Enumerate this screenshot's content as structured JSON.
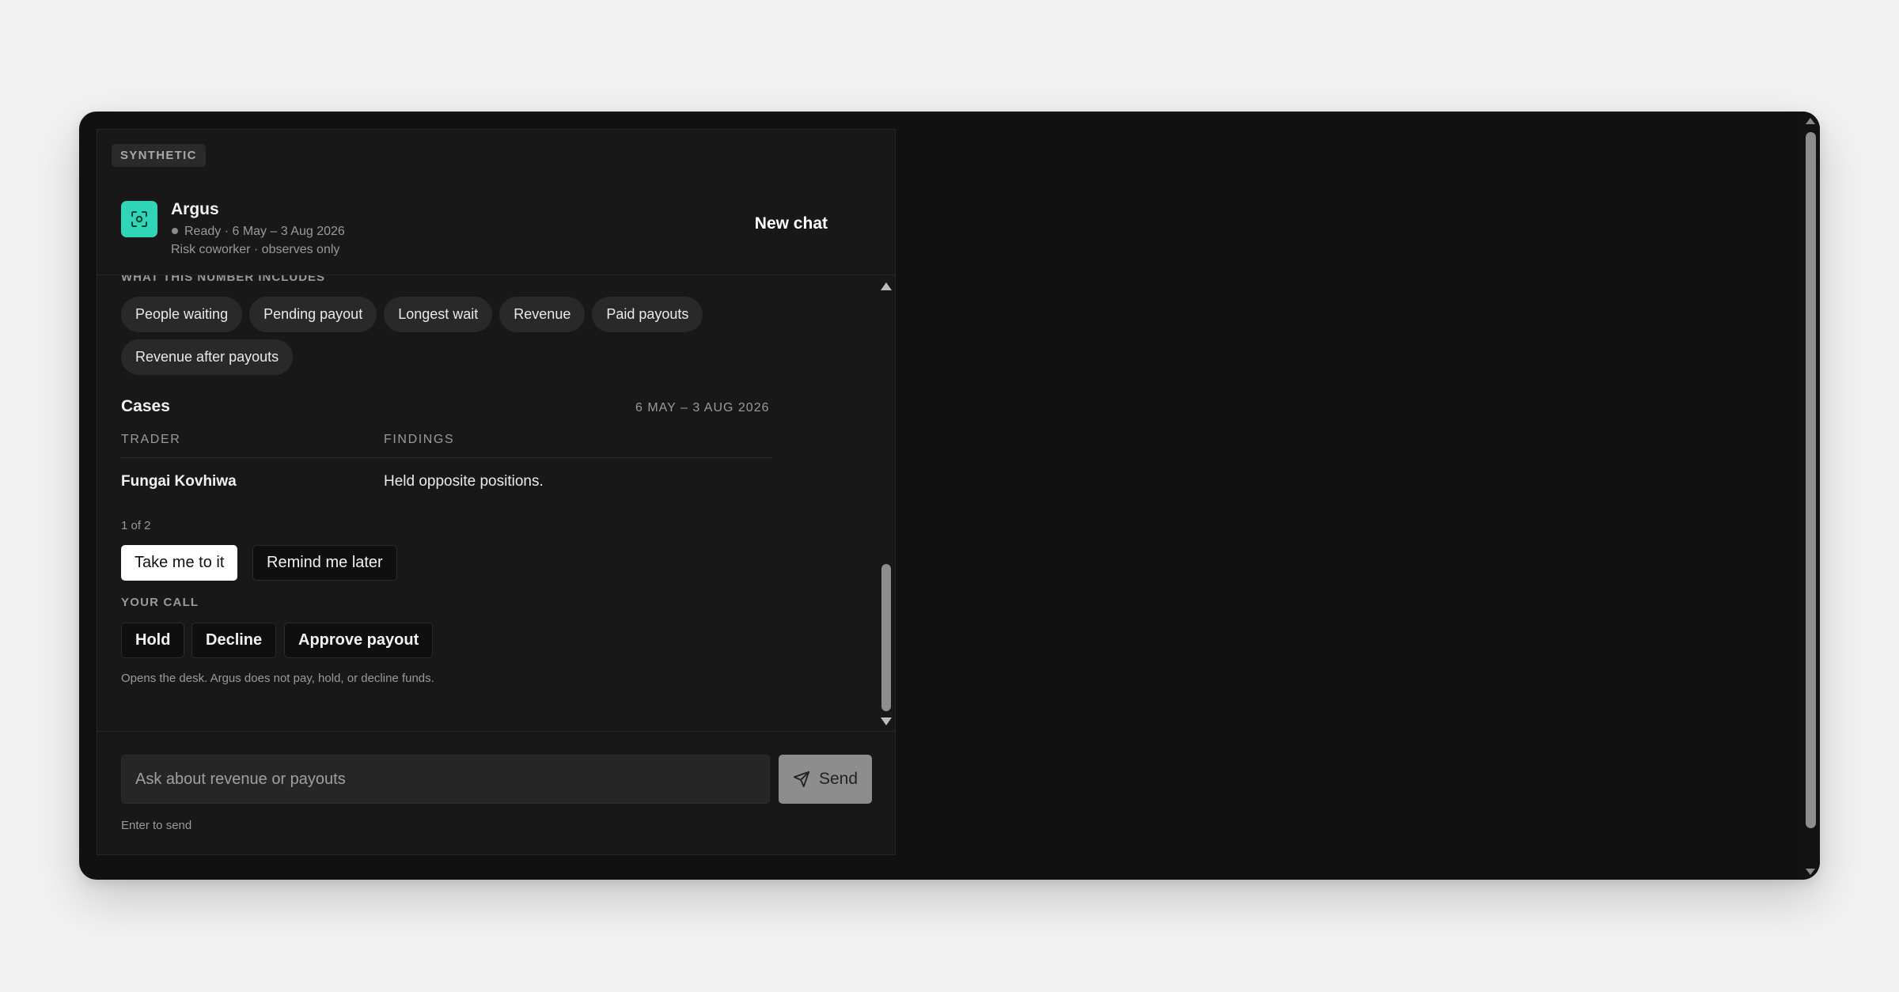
{
  "header": {
    "tag": "SYNTHETIC",
    "assistant_name": "Argus",
    "status": "Ready · 6 May – 3 Aug 2026",
    "role": "Risk coworker · observes only",
    "new_chat_label": "New chat",
    "avatar_icon": "focus-scan-icon",
    "accent_color": "#2ed6b7"
  },
  "breakdown": {
    "section_label": "WHAT THIS NUMBER INCLUDES",
    "chips": [
      "People waiting",
      "Pending payout",
      "Longest wait",
      "Revenue",
      "Paid payouts",
      "Revenue after payouts"
    ]
  },
  "cases": {
    "title": "Cases",
    "range": "6 MAY – 3 AUG 2026",
    "columns": [
      "TRADER",
      "FINDINGS"
    ],
    "rows": [
      {
        "trader": "Fungai Kovhiwa",
        "findings": "Held opposite positions."
      }
    ],
    "pager": "1 of 2",
    "primary_action": "Take me to it",
    "secondary_action": "Remind me later"
  },
  "decision": {
    "label": "YOUR CALL",
    "actions": [
      "Hold",
      "Decline",
      "Approve payout"
    ],
    "disclaimer": "Opens the desk. Argus does not pay, hold, or decline funds."
  },
  "composer": {
    "placeholder": "Ask about revenue or payouts",
    "send_label": "Send",
    "send_icon": "paper-plane-icon",
    "hint": "Enter to send"
  }
}
